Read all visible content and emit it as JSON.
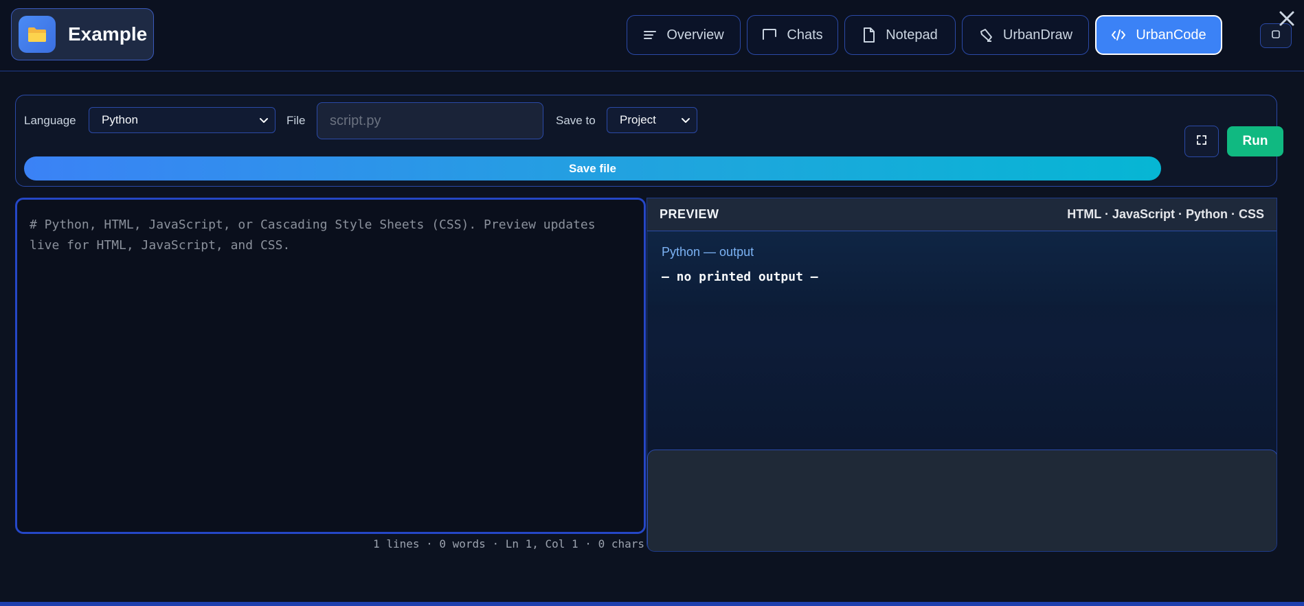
{
  "app": {
    "name": "Example"
  },
  "nav": {
    "items": [
      {
        "label": "Overview",
        "icon": "align-left-icon"
      },
      {
        "label": "Chats",
        "icon": "chat-bubble-icon"
      },
      {
        "label": "Notepad",
        "icon": "document-icon"
      },
      {
        "label": "UrbanDraw",
        "icon": "pen-icon"
      },
      {
        "label": "UrbanCode",
        "icon": "code-icon",
        "active": true
      }
    ]
  },
  "toolbar": {
    "language_label": "Language",
    "language_value": "Python",
    "file_label": "File",
    "file_placeholder": "script.py",
    "save_to_label": "Save to",
    "save_to_value": "Project",
    "save_file_label": "Save file",
    "run_label": "Run"
  },
  "editor": {
    "placeholder": "# Python, HTML, JavaScript, or Cascading Style Sheets (CSS). Preview updates live for HTML, JavaScript, and CSS.",
    "status": "1 lines · 0 words · Ln 1, Col 1 · 0 chars"
  },
  "preview": {
    "title": "PREVIEW",
    "languages": "HTML · JavaScript · Python · CSS",
    "output_label": "Python — output",
    "output_text": "— no printed output —"
  },
  "colors": {
    "accent": "#3b82f6",
    "run": "#10b981",
    "background": "#0c1220",
    "border": "#2b4aa8"
  }
}
